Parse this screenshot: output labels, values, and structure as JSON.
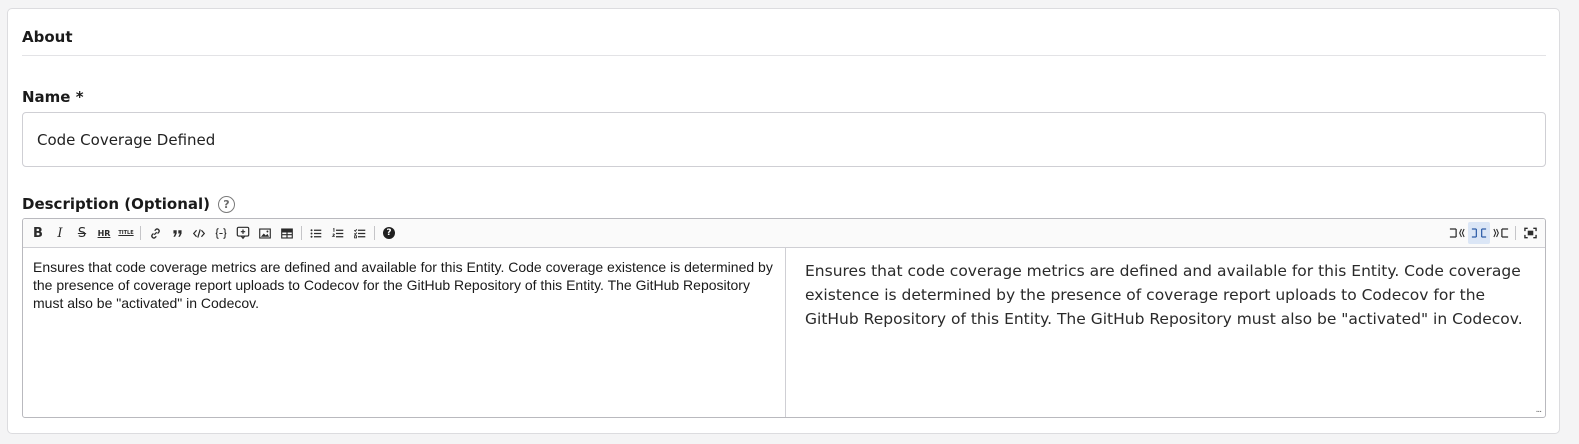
{
  "section": {
    "title": "About"
  },
  "name_field": {
    "label": "Name *",
    "value": "Code Coverage Defined"
  },
  "description_field": {
    "label": "Description (Optional)",
    "help_glyph": "?",
    "editor_text": "Ensures that code coverage metrics are defined and available for this Entity. Code coverage existence is determined by the presence of coverage report uploads to Codecov for the GitHub Repository of this Entity. The GitHub Repository must also be \"activated\" in Codecov.",
    "preview_text": "Ensures that code coverage metrics are defined and available for this Entity. Code coverage existence is determined by the presence of coverage report uploads to Codecov for the GitHub Repository of this Entity. The GitHub Repository must also be \"activated\" in Codecov."
  },
  "toolbar": {
    "bold": "B",
    "italic": "I",
    "strike": "S",
    "hr": "HR",
    "title": "TITLE",
    "help": "?",
    "resize_handle": "..."
  },
  "colors": {
    "accent": "#2f5ea8",
    "active_bg": "#dbe6f6",
    "border": "#cfcfd4"
  }
}
